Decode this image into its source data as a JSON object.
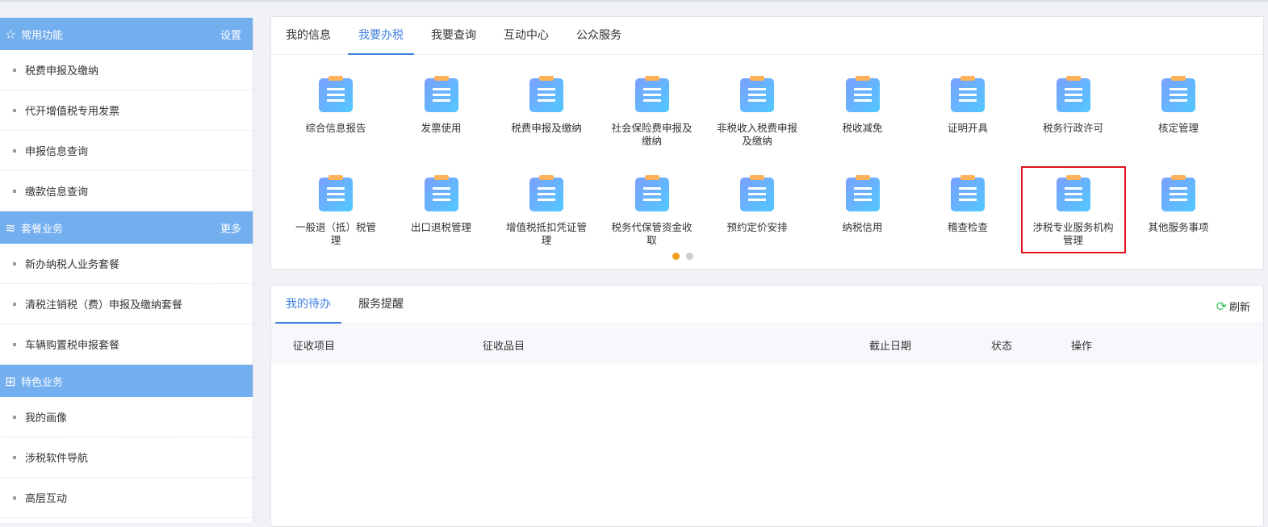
{
  "sidebar": {
    "sections": [
      {
        "title": "常用功能",
        "action": "设置",
        "icon": "star-icon",
        "items": [
          "税费申报及缴纳",
          "代开增值税专用发票",
          "申报信息查询",
          "缴款信息查询"
        ]
      },
      {
        "title": "套餐业务",
        "action": "更多",
        "icon": "layers-icon",
        "items": [
          "新办纳税人业务套餐",
          "清税注销税（费）申报及缴纳套餐",
          "车辆购置税申报套餐"
        ]
      },
      {
        "title": "特色业务",
        "action": "",
        "icon": "grid-icon",
        "items": [
          "我的画像",
          "涉税软件导航",
          "高层互动"
        ]
      }
    ]
  },
  "main": {
    "tabs": [
      "我的信息",
      "我要办税",
      "我要查询",
      "互动中心",
      "公众服务"
    ],
    "active_tab": 1,
    "services": [
      "综合信息报告",
      "发票使用",
      "税费申报及缴纳",
      "社会保险费申报及缴纳",
      "非税收入税费申报及缴纳",
      "税收减免",
      "证明开具",
      "税务行政许可",
      "核定管理",
      "一般退（抵）税管理",
      "出口退税管理",
      "增值税抵扣凭证管理",
      "税务代保管资金收取",
      "预约定价安排",
      "纳税信用",
      "稽查检查",
      "涉税专业服务机构管理",
      "其他服务事项"
    ],
    "highlighted_service": 16,
    "page": 1,
    "pages": 2
  },
  "todo": {
    "tabs": [
      "我的待办",
      "服务提醒"
    ],
    "refresh": "刷新",
    "columns": [
      "征收项目",
      "征收品目",
      "截止日期",
      "状态",
      "操作"
    ]
  },
  "colors": {
    "accent": "#3f7fe0",
    "sidebar_header": "#73aeee",
    "highlight": "#e0141e"
  }
}
